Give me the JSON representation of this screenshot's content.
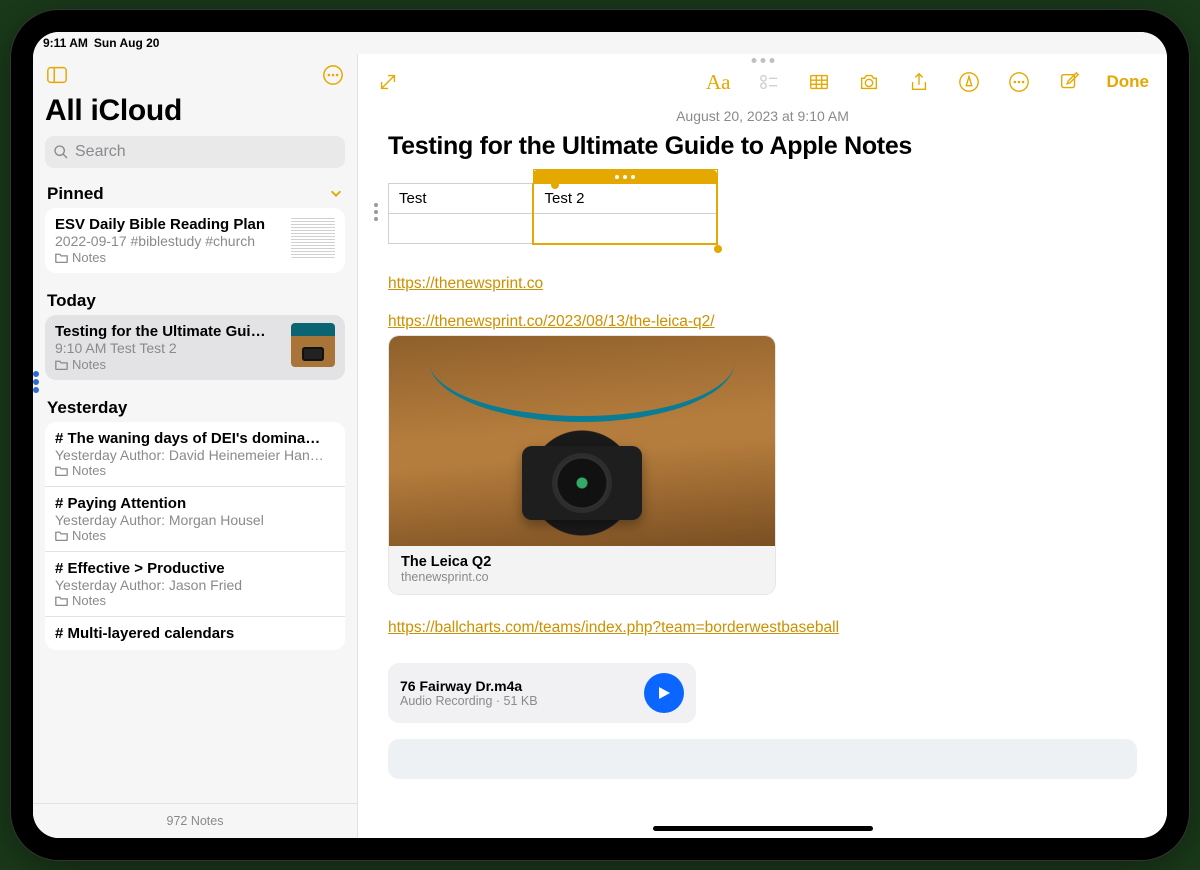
{
  "status": {
    "time": "9:11 AM",
    "date": "Sun Aug 20"
  },
  "sidebar": {
    "title": "All iCloud",
    "search_placeholder": "Search",
    "pinned_label": "Pinned",
    "pinned": {
      "title": "ESV Daily Bible Reading Plan",
      "sub": "2022-09-17  #biblestudy #church",
      "folder": "Notes"
    },
    "today_label": "Today",
    "today": {
      "title": "Testing for the Ultimate Gui…",
      "sub": "9:10 AM  Test Test 2",
      "folder": "Notes"
    },
    "yesterday_label": "Yesterday",
    "yesterday": [
      {
        "title": "# The waning days of DEI's domina…",
        "sub": "Yesterday  Author: David Heinemeier Han…",
        "folder": "Notes"
      },
      {
        "title": "# Paying Attention",
        "sub": "Yesterday  Author: Morgan Housel",
        "folder": "Notes"
      },
      {
        "title": "# Effective > Productive",
        "sub": "Yesterday  Author: Jason Fried",
        "folder": "Notes"
      },
      {
        "title": "# Multi-layered calendars",
        "sub": "",
        "folder": ""
      }
    ],
    "count": "972 Notes"
  },
  "toolbar": {
    "format": "Aa",
    "done": "Done"
  },
  "note": {
    "date": "August 20, 2023 at 9:10 AM",
    "title": "Testing for the Ultimate Guide to Apple Notes",
    "table": {
      "c1": "Test",
      "c2": "Test 2"
    },
    "link1": "https://thenewsprint.co",
    "link2": "https://thenewsprint.co/2023/08/13/the-leica-q2/",
    "preview": {
      "title": "The Leica Q2",
      "site": "thenewsprint.co"
    },
    "link3": "https://ballcharts.com/teams/index.php?team=borderwestbaseball",
    "audio": {
      "name": "76 Fairway Dr.m4a",
      "meta": "Audio Recording · 51 KB"
    }
  }
}
